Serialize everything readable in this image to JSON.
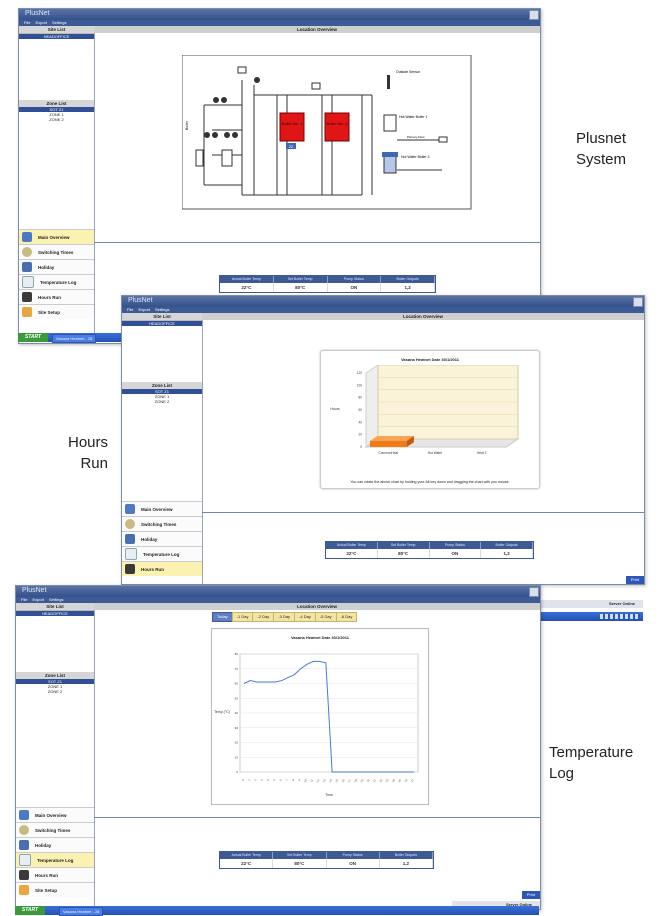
{
  "app": {
    "title": "PlusNet"
  },
  "menu": [
    "File",
    "Export",
    "Settings"
  ],
  "sidebar": {
    "site_list_label": "Site List",
    "site_selected": "HEADOFFICE",
    "zone_list_label": "Zone List",
    "zone_selected": "SOT Z1",
    "zone_items": [
      "ZONE 1",
      "ZONE 2"
    ],
    "nav": [
      "Main Overview",
      "Switching Times",
      "Holiday",
      "Temperature Log",
      "Hours Run",
      "Site Setup"
    ]
  },
  "main": {
    "header": "Location Overview"
  },
  "stats": {
    "headers": [
      "Actual Boiler Temp",
      "Set Boiler Temp",
      "Pump Status",
      "Boiler Outputs"
    ],
    "values": [
      "22°C",
      "80°C",
      "ON",
      "1,2"
    ]
  },
  "captions": {
    "system": "Plusnet\nSystem",
    "hours": "Hours\nRun",
    "temp": "Temperature\nLog"
  },
  "diagram": {
    "boiler1": "Boiler\nNo. 1",
    "boiler2": "Boiler\nNo. 2",
    "temp_badge": "22",
    "outside_label": "Outside\nSensor",
    "hot_water1": "Hot Water\nBoiler 1",
    "hot_water2": "Hot Water\nBoiler 2",
    "return_label": "Boiler",
    "flow_label": "Primary\nFlow"
  },
  "hours_chart": {
    "title": "Vasana Heatnet  Date 30/1/2011",
    "note": "You can rotate the above chart by holding your Alt key down and dragging the chart with you mouse.",
    "ylabel": "Hours",
    "categories": [
      "CommonHeat",
      "Hot Water",
      "Heat 2"
    ]
  },
  "temp_chart": {
    "title": "Vasana Heatnet   Date 30/1/2011",
    "ylabel": "Temp\n(°C)",
    "xlabel": "Time",
    "day_tabs": [
      "Today",
      "-1 Day",
      "-2 Day",
      "-3 Day",
      "-4 Day",
      "-5 Day",
      "-6 Day"
    ]
  },
  "taskbar": {
    "start": "START",
    "tab1": "Vasana Heatnet - 28",
    "status": "Server Online",
    "print": "Print"
  },
  "colors": {
    "accent": "#3d5a96",
    "boiler": "#e01515",
    "bar": "#f07a13",
    "line": "#4a7ad0"
  },
  "chart_data": [
    {
      "type": "bar",
      "title": "Vasana Heatnet  Date 30/1/2011",
      "categories": [
        "CommonHeat",
        "Hot Water",
        "Heat 2"
      ],
      "values": [
        10,
        0,
        0
      ],
      "ylabel": "Hours",
      "ylim": [
        0,
        120
      ]
    },
    {
      "type": "line",
      "title": "Vasana Heatnet   Date 30/1/2011",
      "x": [
        "0",
        "1",
        "2",
        "3",
        "4",
        "5",
        "6",
        "7",
        "8",
        "9",
        "10",
        "11",
        "12",
        "13",
        "14",
        "15",
        "16",
        "17",
        "18",
        "19",
        "20",
        "21",
        "22",
        "23",
        "24",
        "25",
        "26",
        "27"
      ],
      "series": [
        {
          "values": [
            60,
            62,
            61,
            61,
            61,
            61,
            62,
            64,
            66,
            70,
            73,
            75,
            75,
            74,
            0,
            0,
            0,
            0,
            0,
            0,
            0,
            0,
            0,
            0,
            0,
            0,
            0,
            0
          ]
        }
      ],
      "ylabel": "Temp\n(°C)",
      "xlabel": "Time",
      "ylim": [
        0,
        80
      ]
    }
  ]
}
